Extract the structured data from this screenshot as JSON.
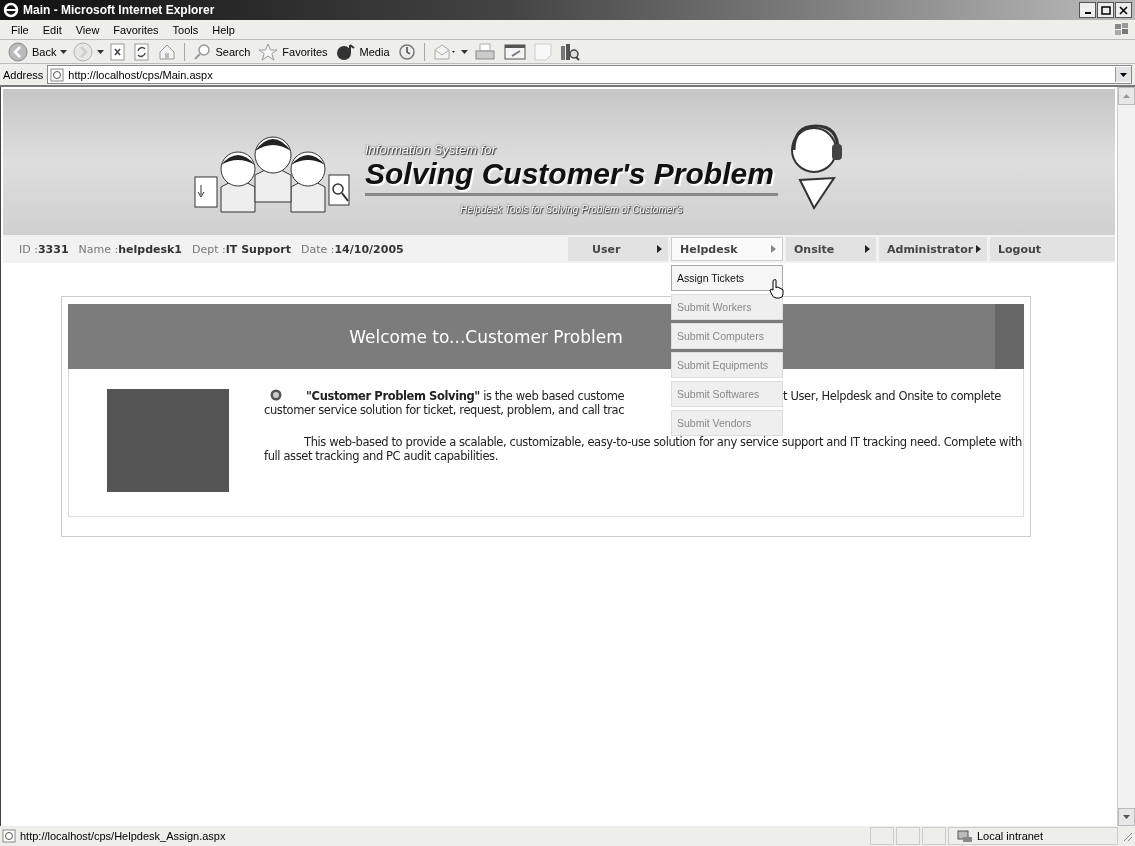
{
  "window": {
    "title": "Main - Microsoft Internet Explorer"
  },
  "menu_bar": [
    "File",
    "Edit",
    "View",
    "Favorites",
    "Tools",
    "Help"
  ],
  "toolbar": [
    {
      "kind": "back",
      "label": "Back",
      "disabled": false
    },
    {
      "kind": "forward",
      "disabled": true
    },
    {
      "kind": "stop",
      "disabled": false
    },
    {
      "kind": "refresh",
      "disabled": false
    },
    {
      "kind": "home",
      "disabled": false
    },
    {
      "kind": "search",
      "label": "Search",
      "disabled": false
    },
    {
      "kind": "favorites",
      "label": "Favorites",
      "disabled": false
    },
    {
      "kind": "media",
      "label": "Media",
      "disabled": false
    },
    {
      "kind": "history",
      "disabled": false
    },
    {
      "kind": "mail",
      "disabled": false
    },
    {
      "kind": "print",
      "disabled": false
    },
    {
      "kind": "edit",
      "disabled": false
    },
    {
      "kind": "discuss",
      "disabled": false
    },
    {
      "kind": "research",
      "disabled": false
    }
  ],
  "address": {
    "label": "Address",
    "value": "http://localhost/cps/Main.aspx"
  },
  "banner": {
    "kicker": "Information System for",
    "title": "Solving Customer's Problem",
    "subtitle": "Helpdesk Tools for Solving Problem of Customer's"
  },
  "user_info": [
    {
      "label": "ID :",
      "value": "3331"
    },
    {
      "label": "Name :",
      "value": "helpdesk1"
    },
    {
      "label": "Dept :",
      "value": "IT Support"
    },
    {
      "label": "Date :",
      "value": "14/10/2005"
    }
  ],
  "nav": [
    {
      "label": "User",
      "has_submenu": true,
      "expanded": false
    },
    {
      "label": "Helpdesk",
      "has_submenu": true,
      "expanded": true
    },
    {
      "label": "Onsite",
      "has_submenu": true,
      "expanded": false
    },
    {
      "label": "Administrator",
      "has_submenu": true,
      "expanded": false
    },
    {
      "label": "Logout",
      "has_submenu": false,
      "expanded": false
    }
  ],
  "dropdown": [
    {
      "label": "Assign Tickets",
      "selected": true
    },
    {
      "label": "Submit Workers",
      "selected": false
    },
    {
      "label": "Submit Computers",
      "selected": false
    },
    {
      "label": "Submit Equipments",
      "selected": false
    },
    {
      "label": "Submit Softwares",
      "selected": false
    },
    {
      "label": "Submit Vendors",
      "selected": false
    }
  ],
  "welcome": {
    "heading": "Welcome to...Customer Problem"
  },
  "intro": {
    "line1_left": "**\"Customer Problem Solving\"** is the web based custome",
    "line1_right": "t User, Helpdesk and Onsite to complete",
    "line2": "customer service solution for ticket, request, problem, and call trac"
  },
  "paragraph": "This web-based to provide a scalable, customizable, easy-to-use solution for any service support and IT tracking need. Complete with full asset tracking and PC audit capabilities.",
  "status_bar": {
    "url": "http://localhost/cps/Helpdesk_Assign.aspx",
    "zone": "Local intranet"
  }
}
